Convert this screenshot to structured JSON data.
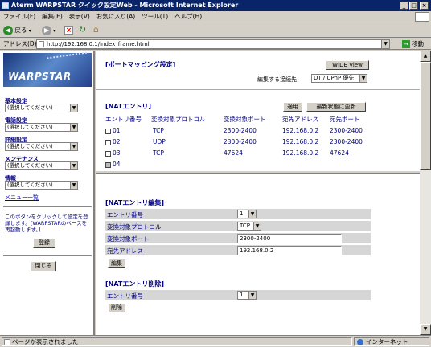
{
  "window": {
    "title": "Aterm WARPSTAR クイック設定Web - Microsoft Internet Explorer",
    "min": "_",
    "max": "□",
    "close": "×"
  },
  "menu": [
    "ファイル(F)",
    "編集(E)",
    "表示(V)",
    "お気に入り(A)",
    "ツール(T)",
    "ヘルプ(H)"
  ],
  "toolbar": {
    "back": "戻る"
  },
  "address": {
    "label": "アドレス(D)",
    "url": "http://192.168.0.1/index_frame.html",
    "go": "移動"
  },
  "left": {
    "logo": "WARPSTAR",
    "sections": [
      {
        "label": "基本設定",
        "select": "(選択してください)"
      },
      {
        "label": "電話設定",
        "select": "(選択してください)"
      },
      {
        "label": "詳細設定",
        "select": "(選択してください)"
      },
      {
        "label": "メンテナンス",
        "select": "(選択してください)"
      },
      {
        "label": "情報",
        "select": "(選択してください)"
      }
    ],
    "menu_list": "メニュー一覧",
    "note": "このボタンをクリックして設定を登録します。[WARPSTARのベースを再起動します。]",
    "register": "登録",
    "close": "閉じる"
  },
  "top": {
    "title": "[ポートマッピング設定]",
    "wide_view": "WIDE View",
    "edit_target_label": "編集する接続先",
    "edit_target_value": "DTI/ UPnP 優先",
    "nat_title": "[NATエントリ]",
    "apply": "適用",
    "refresh": "最新状態に更新",
    "headers": [
      "エントリ番号",
      "変換対象プロトコル",
      "変換対象ポート",
      "宛先アドレス",
      "宛先ポート"
    ],
    "rows": [
      {
        "no": "01",
        "proto": "TCP",
        "port": "2300-2400",
        "addr": "192.168.0.2",
        "dport": "2300-2400"
      },
      {
        "no": "02",
        "proto": "UDP",
        "port": "2300-2400",
        "addr": "192.168.0.2",
        "dport": "2300-2400"
      },
      {
        "no": "03",
        "proto": "TCP",
        "port": "47624",
        "addr": "192.168.0.2",
        "dport": "47624"
      },
      {
        "no": "04",
        "proto": "",
        "port": "",
        "addr": "",
        "dport": ""
      }
    ]
  },
  "edit": {
    "title": "[NATエントリ編集]",
    "fields": [
      {
        "label": "エントリ番号",
        "value": "1"
      },
      {
        "label": "変換対象プロトコル",
        "value": "TCP"
      },
      {
        "label": "変換対象ポート",
        "value": "2300-2400"
      },
      {
        "label": "宛先アドレス",
        "value": "192.168.0.2"
      }
    ],
    "button": "編集"
  },
  "delete": {
    "title": "[NATエントリ削除]",
    "label": "エントリ番号",
    "value": "1",
    "button": "削除"
  },
  "status": {
    "text": "ページが表示されました",
    "zone": "インターネット"
  }
}
